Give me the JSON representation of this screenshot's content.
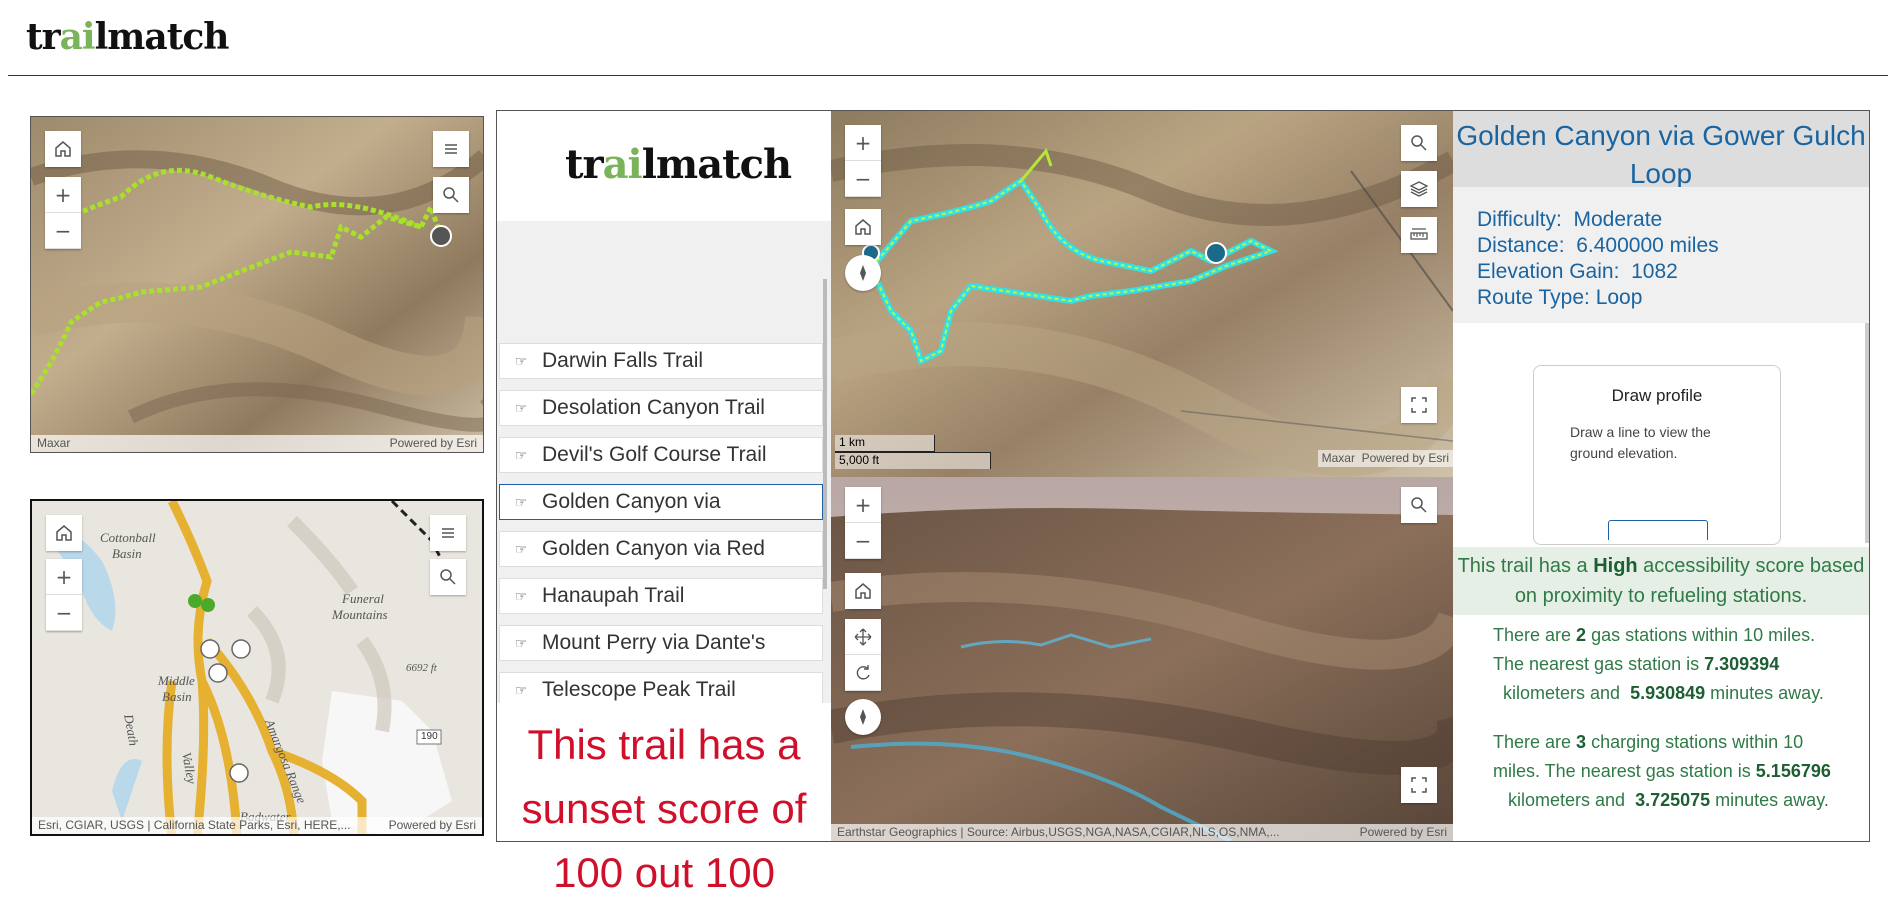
{
  "header": {
    "logo_a": "tr",
    "logo_b": "ai",
    "logo_c": "lmatch"
  },
  "map1": {
    "attr_left": "Maxar",
    "attr_right": "Powered by Esri"
  },
  "map2": {
    "attr_left": "Esri, CGIAR, USGS | California State Parks, Esri, HERE,...",
    "attr_right": "Powered by Esri",
    "labels": {
      "cottonball": "Cottonball",
      "basin1": "Basin",
      "funeral": "Funeral",
      "mountains": "Mountains",
      "middle": "Middle",
      "basin2": "Basin",
      "death": "Death",
      "valley": "Valley",
      "amargosa": "Amargosa Range",
      "badwater": "Badwater",
      "elev": "6692 ft",
      "route": "190"
    }
  },
  "list": {
    "logo_a": "tr",
    "logo_b": "ai",
    "logo_c": "lmatch",
    "items": [
      {
        "label": "Darwin Falls Trail"
      },
      {
        "label": "Desolation Canyon Trail"
      },
      {
        "label": "Devil's Golf Course Trail"
      },
      {
        "label": "Golden Canyon via"
      },
      {
        "label": "Golden Canyon via Red"
      },
      {
        "label": "Hanaupah Trail"
      },
      {
        "label": "Mount Perry via Dante's"
      },
      {
        "label": "Telescope Peak Trail"
      }
    ],
    "selected_index": 3
  },
  "sunset": {
    "line1": "This trail has a",
    "line2": "sunset score of",
    "line3": "100 out 100"
  },
  "map3": {
    "scale_km": "1 km",
    "scale_ft": "5,000 ft",
    "attr_left": "Maxar",
    "attr_right": "Powered by Esri"
  },
  "map4": {
    "attr_left": "Earthstar Geographics | Source: Airbus,USGS,NGA,NASA,CGIAR,NLS,OS,NMA,...",
    "attr_right": "Powered by Esri"
  },
  "info": {
    "title": "Golden Canyon via Gower Gulch Loop",
    "difficulty_label": "Difficulty:",
    "difficulty": "Moderate",
    "distance_label": "Distance:",
    "distance": "6.400000 miles",
    "elevation_label": "Elevation Gain:",
    "elevation": "1082",
    "route_label": "Route Type:",
    "route": "Loop"
  },
  "profile": {
    "title": "Draw profile",
    "text": "Draw a line to view the ground elevation."
  },
  "access": {
    "pre": "This trail has a ",
    "level": "High",
    "post": " accessibility score based on proximity to refueling stations.",
    "gas_pre": "There are ",
    "gas_count": "2",
    "gas_mid": " gas stations within 10 miles. The nearest gas station is ",
    "gas_km": "7.309394",
    "gas_mid2": "  kilometers and  ",
    "gas_min": "5.930849",
    "gas_post": " minutes away.",
    "ch_pre": "There are ",
    "ch_count": "3",
    "ch_mid": " charging stations within 10 miles. The nearest gas station is ",
    "ch_km": "5.156796",
    "ch_mid2": "   kilometers and  ",
    "ch_min": "3.725075",
    "ch_post": " minutes away."
  }
}
